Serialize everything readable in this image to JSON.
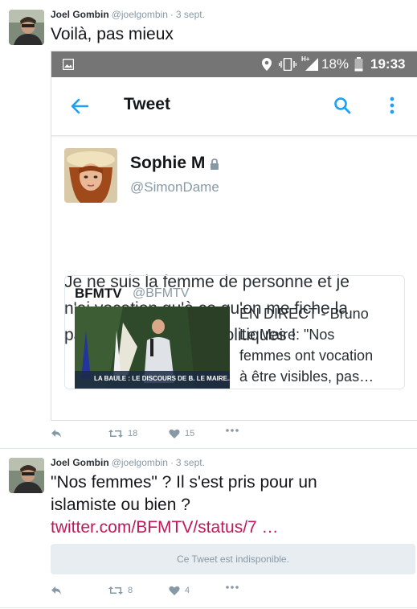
{
  "tweets": [
    {
      "name": "Joel Gombin",
      "handle": "@joelgombin",
      "separator": "·",
      "date": "3 sept.",
      "text": "Voilà, pas mieux",
      "retweets": "18",
      "likes": "15"
    },
    {
      "name": "Joel Gombin",
      "handle": "@joelgombin",
      "separator": "·",
      "date": "3 sept.",
      "text_line1": "\"Nos femmes\" ? Il s'est pris pour un",
      "text_line2": "islamiste ou bien ?",
      "link": "twitter.com/BFMTV/status/7 …",
      "unavailable": "Ce Tweet est indisponible.",
      "retweets": "8",
      "likes": "4"
    }
  ],
  "screenshot": {
    "status": {
      "battery": "18%",
      "time": "19:33",
      "network": "H+"
    },
    "appbar_title": "Tweet",
    "author_name": "Sophie M",
    "author_handle": "@SimonDame",
    "text_line1": "Je ne suis la femme de personne et je",
    "text_line2": "n'ai vocation qu'à ce qu'on me fiche la",
    "text_line3": "paix. Fermez la, les politiques !",
    "quoted": {
      "name": "BFMTV",
      "handle": "@BFMTV",
      "line1": "EN DIRECT - Bruno",
      "line2": "Le Maire: \"Nos",
      "line3": "femmes ont vocation",
      "line4": "à être visibles, pas…",
      "image_caption": "LA BAULE : LE DISCOURS DE B. LE MAIRE..."
    }
  },
  "colors": {
    "twitter_blue": "#1da1f2",
    "link_pink": "#c2185b",
    "status_bar": "#757575",
    "muted": "#8899a6"
  }
}
